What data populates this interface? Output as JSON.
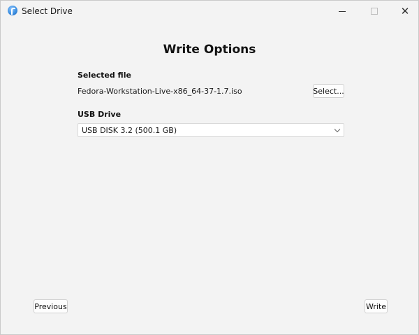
{
  "window": {
    "title": "Select Drive",
    "controls": {
      "minimize": "—",
      "maximize": "☐",
      "close": "✕"
    }
  },
  "main": {
    "heading": "Write Options",
    "selected_file": {
      "label": "Selected file",
      "filename": "Fedora-Workstation-Live-x86_64-37-1.7.iso",
      "select_button": "Select..."
    },
    "usb_drive": {
      "label": "USB Drive",
      "selected": "USB DISK 3.2 (500.1 GB)"
    }
  },
  "footer": {
    "previous_button": "Previous",
    "write_button": "Write"
  },
  "icons": {
    "app": "fedora-media-writer-icon",
    "dropdown": "chevron-down-icon"
  }
}
